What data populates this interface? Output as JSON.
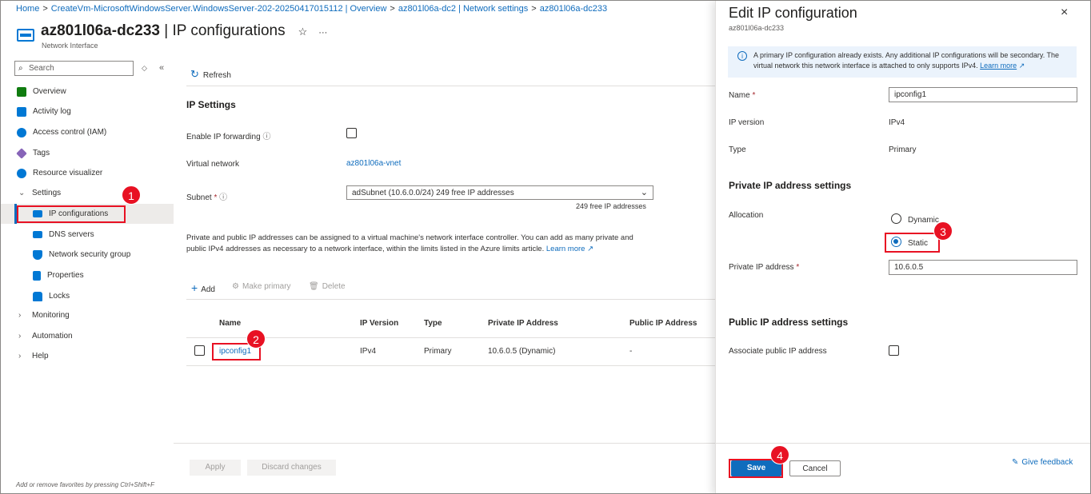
{
  "breadcrumb": {
    "home": "Home",
    "vm": "CreateVm-MicrosoftWindowsServer.WindowsServer-202-20250417015112 | Overview",
    "nic_settings": "az801l06a-dc2 | Network settings",
    "current": "az801l06a-dc233",
    "separator": ">"
  },
  "page": {
    "title_bold": "az801l06a-dc233",
    "title_rest": " | IP configurations",
    "subtitle": "Network Interface",
    "star": "☆",
    "more": "···"
  },
  "sidebar": {
    "search_placeholder": "Search",
    "items": [
      {
        "label": "Overview",
        "color": "#107c10"
      },
      {
        "label": "Activity log",
        "color": "#0078d4"
      },
      {
        "label": "Access control (IAM)",
        "color": "#0078d4"
      },
      {
        "label": "Tags",
        "color": "#8764b8"
      },
      {
        "label": "Resource visualizer",
        "color": "#0078d4"
      },
      {
        "label": "Settings"
      },
      {
        "label": "IP configurations",
        "color": "#0078d4"
      },
      {
        "label": "DNS servers",
        "color": "#0078d4"
      },
      {
        "label": "Network security group",
        "color": "#0078d4"
      },
      {
        "label": "Properties",
        "color": "#0078d4"
      },
      {
        "label": "Locks",
        "color": "#0078d4"
      },
      {
        "label": "Monitoring"
      },
      {
        "label": "Automation"
      },
      {
        "label": "Help"
      }
    ],
    "footer": "Add or remove favorites by pressing Ctrl+Shift+F"
  },
  "toolbar": {
    "refresh": "Refresh"
  },
  "ip_settings": {
    "heading": "IP Settings",
    "forwarding_label": "Enable IP forwarding",
    "vnet_label": "Virtual network",
    "vnet_value": "az801l06a-vnet",
    "subnet_label": "Subnet",
    "subnet_value": "adSubnet (10.6.0.0/24) 249 free IP addresses",
    "subnet_hint": "249 free IP addresses",
    "description": "Private and public IP addresses can be assigned to a virtual machine's network interface controller. You can add as many private and public IPv4 addresses as necessary to a network interface, within the limits listed in the Azure limits article.",
    "learn_more": "Learn more"
  },
  "actions": {
    "add": "Add",
    "make_primary": "Make primary",
    "delete": "Delete"
  },
  "table": {
    "headers": [
      "Name",
      "IP Version",
      "Type",
      "Private IP Address",
      "Public IP Address"
    ],
    "rows": [
      {
        "name": "ipconfig1",
        "version": "IPv4",
        "type": "Primary",
        "private": "10.6.0.5 (Dynamic)",
        "public": "-"
      }
    ]
  },
  "footer": {
    "apply": "Apply",
    "discard": "Discard changes"
  },
  "panel": {
    "title": "Edit IP configuration",
    "subtitle": "az801l06a-dc233",
    "info": "A primary IP configuration already exists. Any additional IP configurations will be secondary. The virtual network this network interface is attached to only supports IPv4.",
    "info_link": "Learn more",
    "name_label": "Name",
    "name_value": "ipconfig1",
    "version_label": "IP version",
    "version_value": "IPv4",
    "type_label": "Type",
    "type_value": "Primary",
    "private_section": "Private IP address settings",
    "allocation_label": "Allocation",
    "dynamic": "Dynamic",
    "static": "Static",
    "allocation_selected": "Static",
    "private_ip_label": "Private IP address",
    "private_ip_value": "10.6.0.5",
    "public_section": "Public IP address settings",
    "associate_label": "Associate public IP address",
    "save": "Save",
    "cancel": "Cancel",
    "feedback": "Give feedback"
  },
  "annotations": [
    "1",
    "2",
    "3",
    "4"
  ]
}
